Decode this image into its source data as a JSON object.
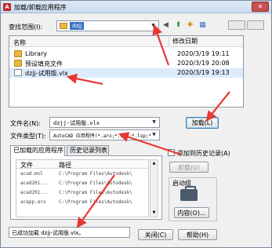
{
  "window": {
    "title": "加载/卸载应用程序",
    "close": "✕",
    "app_icon_text": "A"
  },
  "lookin": {
    "label": "查找范围(I):",
    "value": "dzjj"
  },
  "file_list": {
    "col_name": "名称",
    "col_date": "修改日期",
    "rows": [
      {
        "name": "Library",
        "date": "2020/3/19 19:11",
        "type": "folder"
      },
      {
        "name": "预设填充文件",
        "date": "2020/3/19 20:08",
        "type": "folder"
      },
      {
        "name": "dzjj-试用版.vlx",
        "date": "2020/3/19 19:13",
        "type": "file"
      }
    ]
  },
  "filename": {
    "label": "文件名(N):",
    "value": "dzjj-试用版.vlx"
  },
  "filetype": {
    "label": "文件类型(T):",
    "value": "AutoCAD 应用程序(*.arx;*.crx;*.lsp;*"
  },
  "load_button": "加载(L)",
  "tabs": {
    "loaded": "已加载的应用程序",
    "history": "历史记录列表"
  },
  "app_table": {
    "col_file": "文件",
    "col_path": "路径",
    "rows": [
      {
        "file": "acad.mnl",
        "path": "C:\\Program Files\\Autodesk\\"
      },
      {
        "file": "acad201...",
        "path": "C:\\Program Files\\Autodesk\\"
      },
      {
        "file": "acad201...",
        "path": "C:\\Program Files\\Autodesk\\"
      },
      {
        "file": "acapp.arx",
        "path": "C:\\Program Files\\Autodesk\\"
      }
    ]
  },
  "add_history": "添加到历史记录(A)",
  "unload_button": "卸载(U)",
  "startup": {
    "label": "启动组",
    "contents_button": "内容(O)..."
  },
  "status_text": "已成功加载 dzjj-试用版.vlx。",
  "close_button": "关闭(C)",
  "help_button": "帮助(H)",
  "toolbar_icons": [
    "back-icon",
    "up-folder-icon",
    "new-folder-icon",
    "view-menu-icon"
  ],
  "colors": {
    "folder": "#e8b83d",
    "annotation_arrow": "#e53935",
    "selection": "#dcebfc"
  }
}
